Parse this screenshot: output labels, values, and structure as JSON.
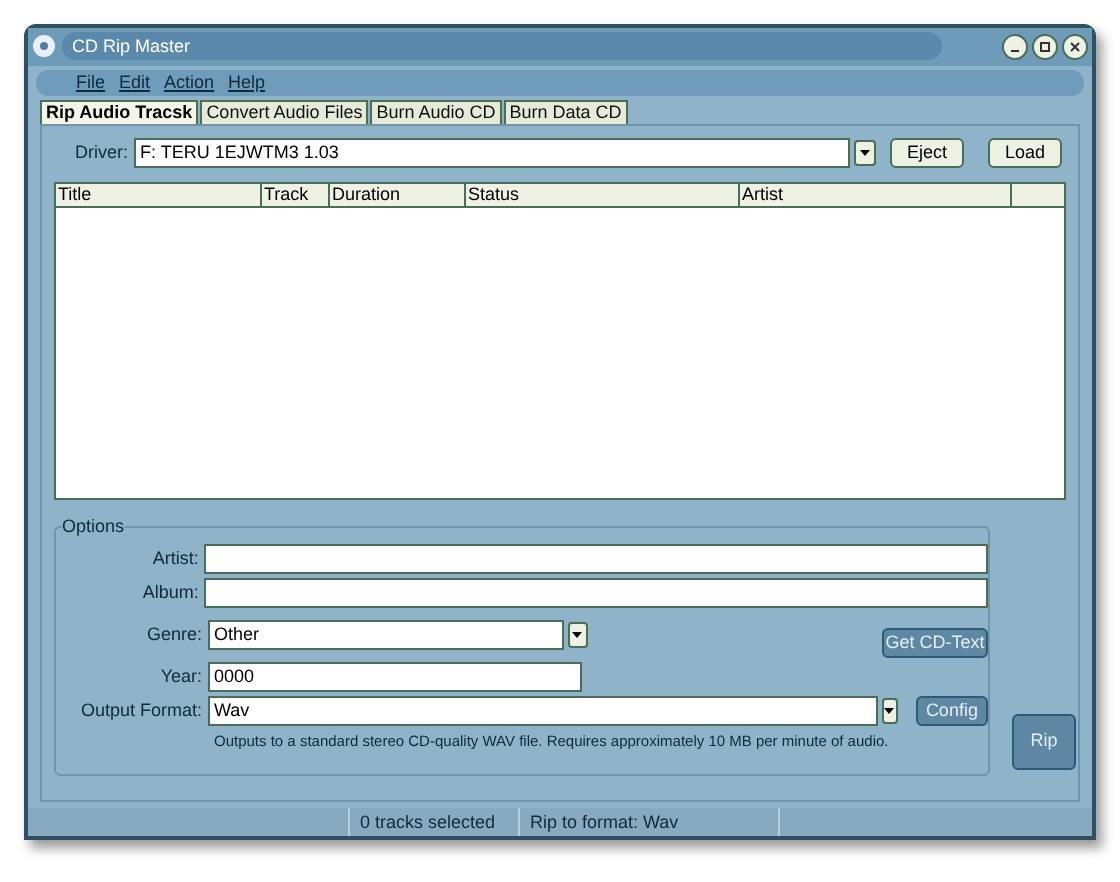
{
  "window": {
    "title": "CD Rip Master"
  },
  "menu": [
    {
      "label": "File"
    },
    {
      "label": "Edit"
    },
    {
      "label": "Action"
    },
    {
      "label": "Help"
    }
  ],
  "tabs": [
    {
      "label": "Rip Audio Tracsk",
      "selected": true
    },
    {
      "label": "Convert Audio Files",
      "selected": false
    },
    {
      "label": "Burn Audio CD",
      "selected": false
    },
    {
      "label": "Burn Data CD",
      "selected": false
    }
  ],
  "driver": {
    "label": "Driver:",
    "value": "F: TERU 1EJWTM3 1.03"
  },
  "buttons": [
    {
      "label": "Eject",
      "disabled": false
    },
    {
      "label": "Load",
      "disabled": false
    }
  ],
  "table": {
    "columns": [
      "Title",
      "Track",
      "Duration",
      "Status",
      "Artist"
    ]
  },
  "options": {
    "title": "Options",
    "artist": {
      "label": "Artist:"
    },
    "album": {
      "label": "Album:"
    },
    "genre": {
      "label": "Genre:",
      "value": "Other"
    },
    "year": {
      "label": "Year:",
      "value": "0000"
    },
    "format": {
      "label": "Output Format:",
      "value": "Wav"
    },
    "description": "Outputs to a standard stereo CD-quality WAV file.  Requires approximately 10 MB per minute of audio.",
    "get_cd_text": {
      "label": "Get CD-Text",
      "disabled": true
    },
    "config": {
      "label": "Config",
      "disabled": true
    }
  },
  "rip": {
    "label": "Rip",
    "disabled": true
  },
  "status_bar": [
    "0 tracks selected",
    "Rip to format: Wav"
  ]
}
